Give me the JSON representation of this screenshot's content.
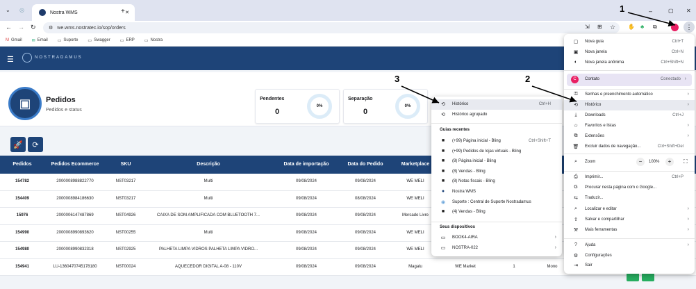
{
  "browser": {
    "tab_title": "Nostra WMS",
    "url": "we.wms.nostratec.io/sop/orders",
    "bookmarks": [
      "Gmail",
      "Email",
      "Suporte",
      "Swagger",
      "ERP",
      "Nostra"
    ]
  },
  "app": {
    "brand": "NOSTRADAMUS",
    "page_title": "Pedidos",
    "page_subtitle": "Pedidos e status",
    "stats": [
      {
        "label": "Pendentes",
        "value": "0",
        "percent": "0%"
      },
      {
        "label": "Separação",
        "value": "0",
        "percent": "0%"
      }
    ],
    "table": {
      "headers": [
        "Pedidos",
        "Pedidos Ecommerce",
        "SKU",
        "Descrição",
        "Data de importação",
        "Data do Pedido",
        "Marketplace"
      ],
      "rows": [
        [
          "154782",
          "2000008988822770",
          "NST03217",
          "Multi",
          "09/08/2024",
          "09/08/2024",
          "WE MELI"
        ],
        [
          "154409",
          "2000008984186630",
          "NST03217",
          "Multi",
          "09/08/2024",
          "08/08/2024",
          "WE MELI"
        ],
        [
          "15976",
          "2000006147487869",
          "NST04926",
          "CAIXA DE SOM AMPLIFICADA COM BLUETOOTH 7...",
          "09/08/2024",
          "09/08/2024",
          "Mercado Livre"
        ],
        [
          "154990",
          "2000008990893620",
          "NST00255",
          "Multi",
          "09/08/2024",
          "09/08/2024",
          "WE MELI"
        ],
        [
          "154980",
          "2000008990832318",
          "NST02925",
          "PALHETA LIMPA VIDROS PALHETA LIMPA VIDRO...",
          "09/08/2024",
          "09/08/2024",
          "WE MELI"
        ],
        [
          "154941",
          "LU-1360470745178180",
          "NST00024",
          "AQUECEDOR DIGITAL A-08 - 110V",
          "09/08/2024",
          "09/08/2024",
          "Magalu"
        ]
      ],
      "row6_extra": [
        "WE Market",
        "1",
        "Mono"
      ]
    }
  },
  "history_submenu": {
    "items": [
      {
        "label": "Histórico",
        "shortcut": "Ctrl+H"
      },
      {
        "label": "Histórico agrupado",
        "shortcut": ""
      }
    ],
    "recent_title": "Guias recentes",
    "recent": [
      {
        "label": "(+99) Página inicial - Bling",
        "shortcut": "Ctrl+Shift+T"
      },
      {
        "label": "(+99) Pedidos de lojas virtuais - Bling",
        "shortcut": ""
      },
      {
        "label": "(8) Página inicial - Bling",
        "shortcut": ""
      },
      {
        "label": "(8) Vendas - Bling",
        "shortcut": ""
      },
      {
        "label": "(8) Notas fiscais - Bling",
        "shortcut": ""
      },
      {
        "label": "Nostra WMS",
        "shortcut": ""
      },
      {
        "label": "Suporte : Central de Suporte Nostradamus",
        "shortcut": ""
      },
      {
        "label": "(4) Vendas - Bling",
        "shortcut": ""
      }
    ],
    "devices_title": "Seus dispositivos",
    "devices": [
      "BOOK4-AIRA",
      "NOSTRA-022"
    ]
  },
  "chrome_menu": {
    "items": [
      {
        "label": "Nova guia",
        "shortcut": "Ctrl+T"
      },
      {
        "label": "Nova janela",
        "shortcut": "Ctrl+N"
      },
      {
        "label": "Nova janela anônima",
        "shortcut": "Ctrl+Shift+N"
      }
    ],
    "profile_name": "Contato",
    "profile_status": "Conectado",
    "items2": [
      {
        "label": "Senhas e preenchimento automático",
        "shortcut": ""
      },
      {
        "label": "Histórico",
        "shortcut": ""
      },
      {
        "label": "Downloads",
        "shortcut": "Ctrl+J"
      },
      {
        "label": "Favoritos e listas",
        "shortcut": ""
      },
      {
        "label": "Extensões",
        "shortcut": ""
      },
      {
        "label": "Excluir dados de navegação...",
        "shortcut": "Ctrl+Shift+Del"
      }
    ],
    "zoom_label": "Zoom",
    "zoom_value": "100%",
    "zoom_minus": "−",
    "zoom_plus": "+",
    "items3": [
      {
        "label": "Imprimir...",
        "shortcut": "Ctrl+P"
      },
      {
        "label": "Procurar nesta página com o Google...",
        "shortcut": ""
      },
      {
        "label": "Traduzir...",
        "shortcut": ""
      },
      {
        "label": "Localizar e editar",
        "shortcut": ""
      },
      {
        "label": "Salvar e compartilhar",
        "shortcut": ""
      },
      {
        "label": "Mais ferramentas",
        "shortcut": ""
      }
    ],
    "items4": [
      {
        "label": "Ajuda",
        "shortcut": ""
      },
      {
        "label": "Configurações",
        "shortcut": ""
      },
      {
        "label": "Sair",
        "shortcut": ""
      }
    ]
  },
  "annotations": [
    "1",
    "2",
    "3"
  ],
  "colors": {
    "brand": "#1e4478",
    "accent": "#3a7bc8",
    "action_green": "#27ae60"
  }
}
